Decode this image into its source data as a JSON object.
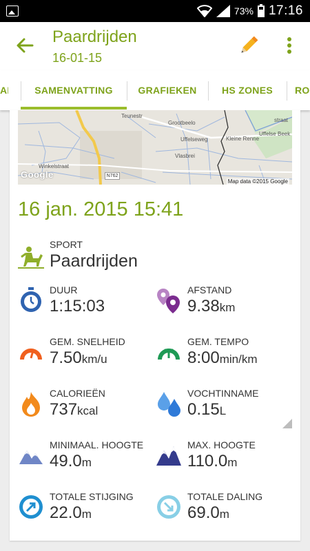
{
  "status_bar": {
    "battery_pct": "73%",
    "time": "17:16"
  },
  "header": {
    "title": "Paardrijden",
    "subtitle": "16-01-15"
  },
  "tabs": [
    {
      "label": "AL"
    },
    {
      "label": "SAMENVATTING"
    },
    {
      "label": "GRAFIEKEN"
    },
    {
      "label": "HS ZONES"
    },
    {
      "label": "RO"
    }
  ],
  "map": {
    "labels": [
      "Teunestr",
      "Grootbeelo",
      "Uffelseweg",
      "Uffelse Beek",
      "Kleine Renne",
      "Vlasbrei",
      "Winkelstraat",
      "straat"
    ],
    "road_badge": "N762",
    "google": "Google",
    "credit": "Map data ©2015 Google"
  },
  "workout": {
    "datetime": "16 jan. 2015 15:41",
    "sport": {
      "label": "SPORT",
      "value": "Paardrijden"
    },
    "stats": [
      {
        "label": "DUUR",
        "value": "1:15:03",
        "unit": "",
        "icon": "stopwatch-icon"
      },
      {
        "label": "AFSTAND",
        "value": "9.38",
        "unit": "km",
        "icon": "location-pins-icon"
      },
      {
        "label": "GEM. SNELHEID",
        "value": "7.50",
        "unit": "km/u",
        "icon": "speed-gauge-icon"
      },
      {
        "label": "GEM. TEMPO",
        "value": "8:00",
        "unit": "min/km",
        "icon": "pace-gauge-icon"
      },
      {
        "label": "CALORIEËN",
        "value": "737",
        "unit": "kcal",
        "icon": "flame-icon"
      },
      {
        "label": "VOCHTINNAME",
        "value": "0.15",
        "unit": "L",
        "icon": "water-drops-icon"
      },
      {
        "label": "MINIMAAL. HOOGTE",
        "value": "49.0",
        "unit": "m",
        "icon": "mountain-low-icon"
      },
      {
        "label": "MAX. HOOGTE",
        "value": "110.0",
        "unit": "m",
        "icon": "mountain-high-icon"
      },
      {
        "label": "TOTALE STIJGING",
        "value": "22.0",
        "unit": "m",
        "icon": "ascent-arrow-icon"
      },
      {
        "label": "TOTALE DALING",
        "value": "69.0",
        "unit": "m",
        "icon": "descent-arrow-icon"
      }
    ]
  },
  "colors": {
    "accent": "#7ea31b",
    "blue": "#2f63b0",
    "purple": "#8b3fa0",
    "orange": "#f0601e",
    "green": "#1e9a55",
    "fire": "#f28a1c",
    "water": "#3d8fe0",
    "mountain": "#4a5fa8",
    "mountain_dark": "#343b8c",
    "ascent": "#1f8fd0",
    "descent": "#88cfe6"
  }
}
